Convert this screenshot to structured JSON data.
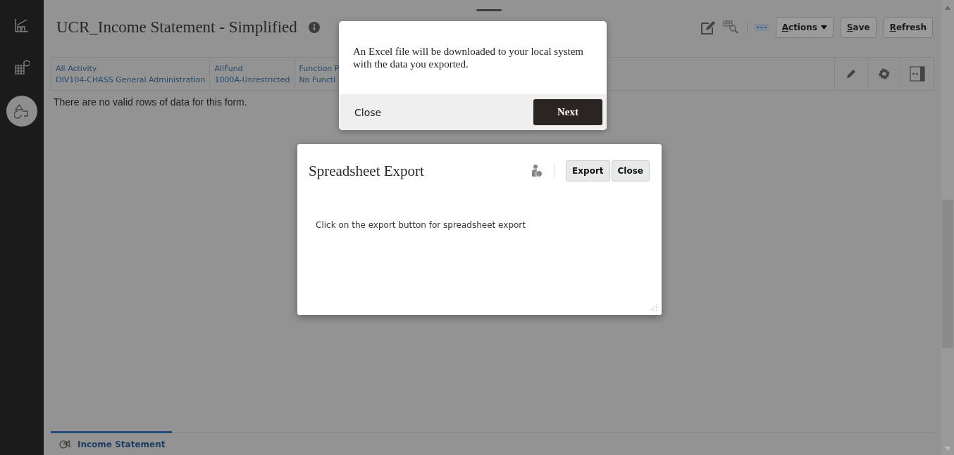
{
  "sidebar": {
    "items": [
      {
        "selected": false
      },
      {
        "selected": false
      },
      {
        "selected": true
      }
    ]
  },
  "form": {
    "title": "UCR_Income Statement - Simplified",
    "toolbar_buttons": [
      {
        "label": "Actions",
        "kind": "menu",
        "mnemonic": true
      },
      {
        "label": "Save",
        "kind": "plain",
        "mnemonic": true
      },
      {
        "label": "Refresh",
        "kind": "plain",
        "mnemonic": true
      }
    ],
    "pov": [
      {
        "dimension": "All Activity",
        "member": "DIV104-CHASS General Administration"
      },
      {
        "dimension": "AllFund",
        "member": "1000A-Unrestricted"
      },
      {
        "dimension": "Function P",
        "member": "No Functi"
      }
    ],
    "message": "There are no valid rows of data for this form."
  },
  "tabs": [
    {
      "label": "Income Statement",
      "selected": true
    }
  ],
  "confirm_popup": {
    "text": "An Excel file will be downloaded to your local system with the data you exported.",
    "close": "Close",
    "next": "Next"
  },
  "export_dialog": {
    "title": "Spreadsheet Export",
    "buttons": [
      "Export",
      "Close"
    ],
    "body": "Click on the export button for spreadsheet export"
  }
}
